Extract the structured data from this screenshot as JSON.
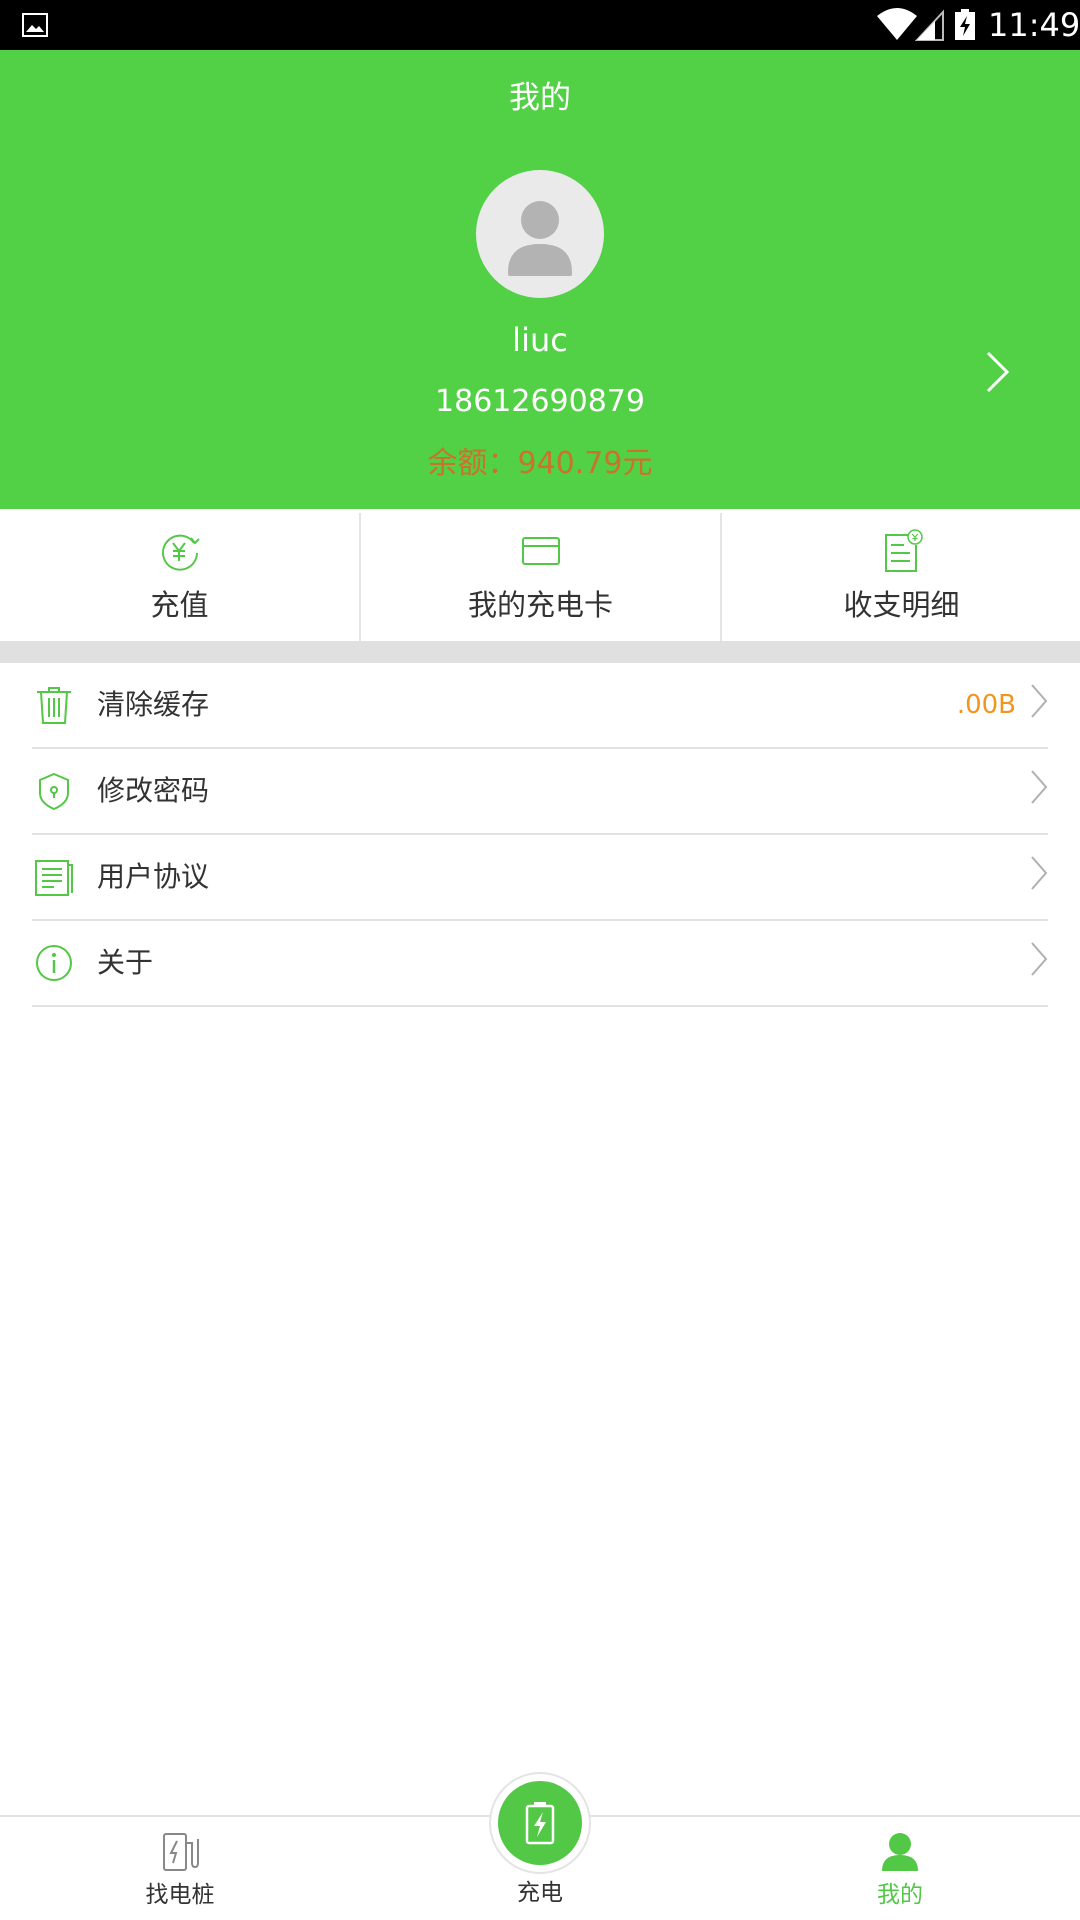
{
  "status_bar": {
    "time": "11:49",
    "icons": [
      "image-icon",
      "wifi-icon",
      "signal-icon",
      "battery-charging-icon"
    ]
  },
  "header": {
    "title": "我的",
    "avatar_icon": "user-avatar-icon",
    "username": "liuc",
    "phone": "18612690879",
    "balance": "余额：940.79元",
    "chevron_icon": "chevron-right-icon"
  },
  "quick_actions": [
    {
      "label": "充值",
      "icon": "recharge-yen-icon"
    },
    {
      "label": "我的充电卡",
      "icon": "card-icon"
    },
    {
      "label": "收支明细",
      "icon": "bill-details-icon"
    }
  ],
  "settings": [
    {
      "label": "清除缓存",
      "icon": "trash-icon",
      "value": ".00B"
    },
    {
      "label": "修改密码",
      "icon": "shield-lock-icon",
      "value": ""
    },
    {
      "label": "用户协议",
      "icon": "document-icon",
      "value": ""
    },
    {
      "label": "关于",
      "icon": "info-icon",
      "value": ""
    }
  ],
  "bottom_nav": {
    "items": [
      {
        "label": "找电桩",
        "icon": "charging-station-icon",
        "active": false
      },
      {
        "label": "充电",
        "icon": "battery-bolt-icon",
        "active": false
      },
      {
        "label": "我的",
        "icon": "profile-icon",
        "active": true
      }
    ]
  },
  "colors": {
    "brand_green": "#52d046",
    "balance_text": "#c8742a",
    "cache_value": "#f0961e",
    "active_nav": "#52c846"
  }
}
